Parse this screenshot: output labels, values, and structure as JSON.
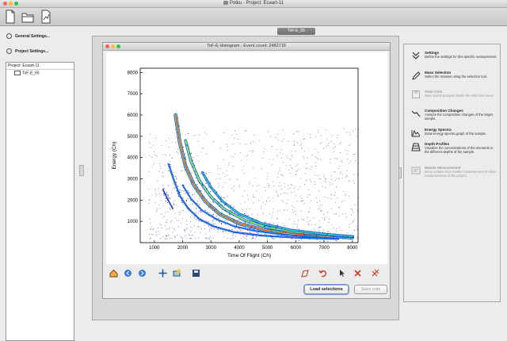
{
  "window": {
    "title": "Potku - Project: Ecaart-11"
  },
  "colors": {
    "close": "#ff5f57",
    "minimize": "#ffbd2e",
    "maximize": "#28c940",
    "tab_active": "#7a7a7a"
  },
  "toolbar": {
    "icons": [
      "new-project-icon",
      "open-folder-icon",
      "open-document-icon"
    ]
  },
  "left_panel": {
    "general_settings": "General Settings...",
    "project_settings": "Project Settings...",
    "tree_root": "Project: Ecaart-11",
    "tree_items": [
      "ToF-E_65"
    ]
  },
  "tab": {
    "label": "ToF-E_65"
  },
  "histogram": {
    "window_title": "ToF-E Histogram - Event count: 2482718",
    "load_selections": "Load selections",
    "save_cuts": "Save cuts"
  },
  "right_panel": {
    "items": [
      {
        "title": "Settings",
        "desc": "Define the settings for this specific measurement.",
        "enabled": true,
        "icon": "double-chevron-icon"
      },
      {
        "title": "Mass Selection",
        "desc": "Select the masses using the selection tool.",
        "enabled": true,
        "icon": "pencil-icon"
      },
      {
        "title": "Save Cuts",
        "desc": "Save points grouped inside the selection areas.",
        "enabled": false,
        "icon": "save-cuts-icon"
      },
      {
        "title": "Composition Changes",
        "desc": "Analyze the composition changes of the target sample.",
        "enabled": true,
        "icon": "composition-icon"
      },
      {
        "title": "Energy Spectra",
        "desc": "Draw energy spectra graph of the sample.",
        "enabled": true,
        "icon": "energy-spectra-icon"
      },
      {
        "title": "Depth Profiles",
        "desc": "Visualize the concentrations of the elements in the different depths of the sample.",
        "enabled": true,
        "icon": "depth-profiles-icon"
      },
      {
        "title": "Master Measurement",
        "desc": "Issue actions from master measurement to slave measurements of the project.",
        "enabled": false,
        "icon": "master-measurement-icon"
      }
    ]
  },
  "chart_data": {
    "type": "heatmap",
    "title": "",
    "xlabel": "Time Of Flight (Ch)",
    "ylabel": "Energy (Ch)",
    "xlim": [
      500,
      8200
    ],
    "ylim": [
      0,
      8200
    ],
    "xticks": [
      "1000",
      "2000",
      "3000",
      "4000",
      "5000",
      "6000",
      "7000",
      "8000"
    ],
    "yticks": [
      "1000",
      "2000",
      "3000",
      "4000",
      "5000",
      "6000",
      "7000",
      "8000"
    ],
    "colormap": "jet",
    "series": [
      {
        "x": [
          1750,
          1900,
          2100,
          2400,
          2800,
          3300,
          4000,
          5000,
          6200,
          8000
        ],
        "y": [
          6000,
          4700,
          3600,
          2700,
          1950,
          1350,
          900,
          560,
          380,
          240
        ]
      },
      {
        "x": [
          2100,
          2300,
          2600,
          3000,
          3500,
          4200,
          5000,
          6000,
          7000,
          8000
        ],
        "y": [
          4800,
          3800,
          2900,
          2150,
          1550,
          1050,
          720,
          500,
          370,
          280
        ]
      },
      {
        "x": [
          2700,
          3000,
          3400,
          4000,
          4800,
          5800,
          7000,
          8000
        ],
        "y": [
          3300,
          2600,
          1950,
          1350,
          900,
          600,
          400,
          300
        ]
      },
      {
        "x": [
          1500,
          1700,
          1900,
          2200,
          2600,
          3100,
          3800,
          4800,
          6000,
          7500
        ],
        "y": [
          3700,
          2900,
          2200,
          1600,
          1100,
          760,
          500,
          330,
          240,
          170
        ]
      },
      {
        "x": [
          2000,
          2300,
          2700,
          3200,
          3800,
          4600,
          5600,
          6800
        ],
        "y": [
          2700,
          2050,
          1500,
          1100,
          780,
          540,
          370,
          250
        ]
      },
      {
        "x": [
          1300,
          1450,
          1650
        ],
        "y": [
          2500,
          2100,
          1600
        ]
      }
    ]
  }
}
